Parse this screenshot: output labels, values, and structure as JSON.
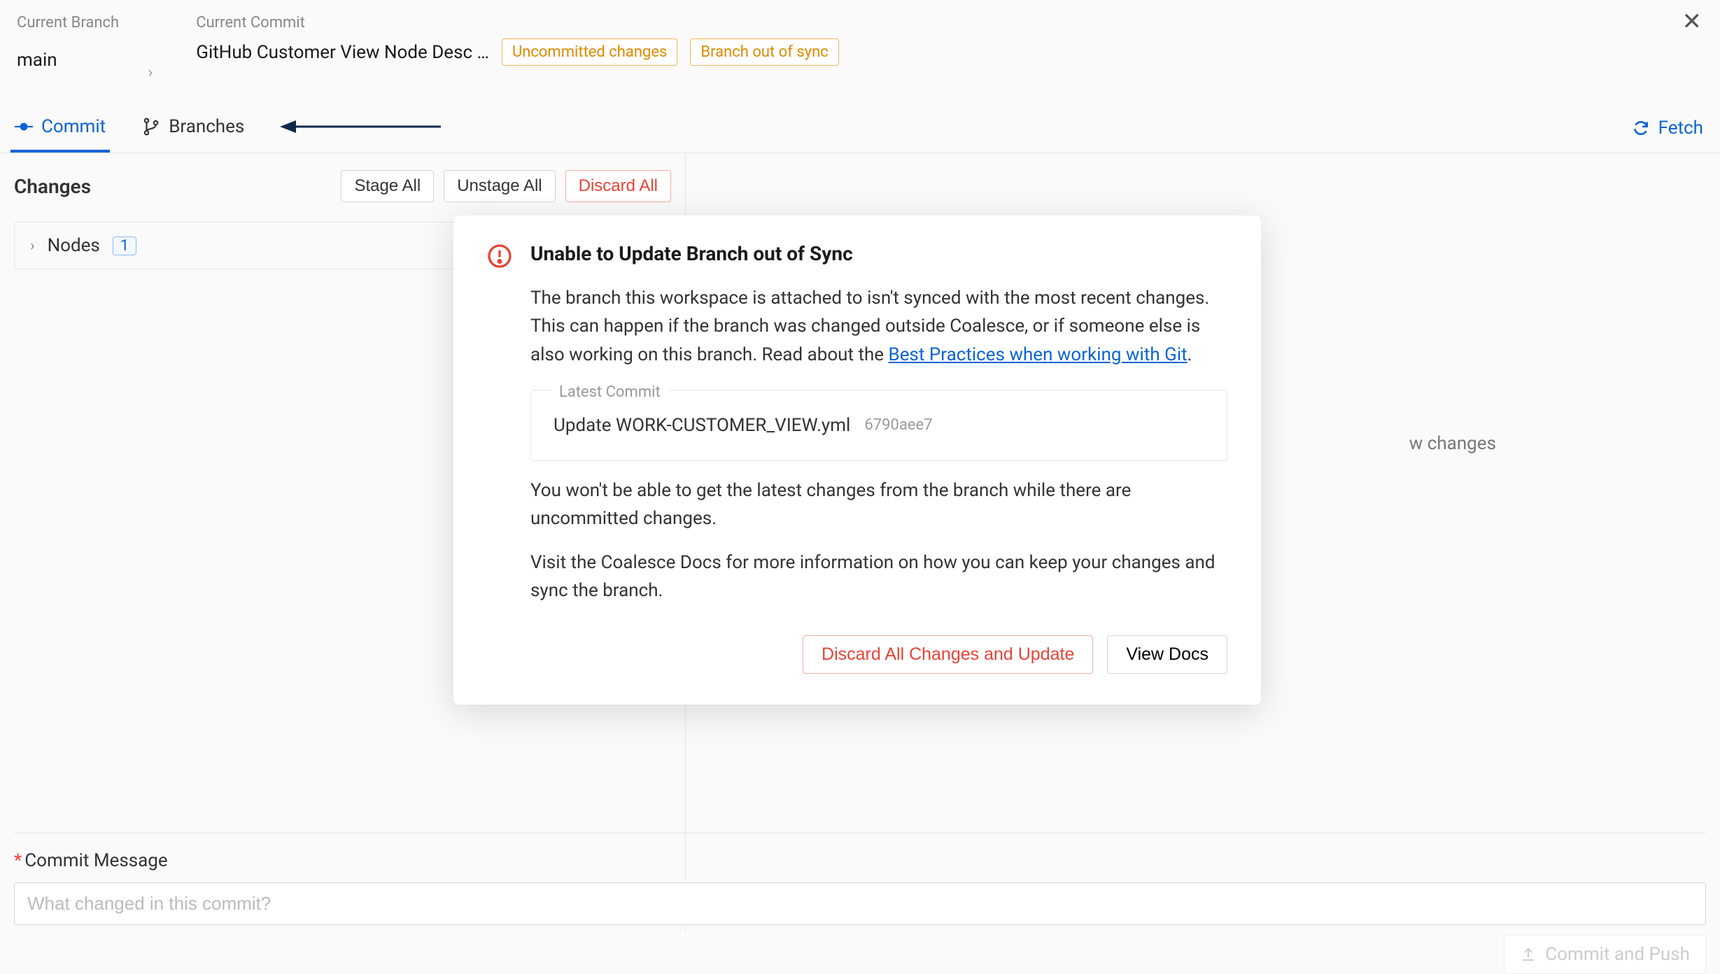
{
  "header": {
    "branch_label": "Current Branch",
    "branch_value": "main",
    "commit_label": "Current Commit",
    "commit_value": "GitHub Customer View Node Desc …",
    "badge_uncommitted": "Uncommitted changes",
    "badge_sync": "Branch out of sync"
  },
  "tabs": {
    "commit": "Commit",
    "branches": "Branches",
    "fetch": "Fetch"
  },
  "changes": {
    "title": "Changes",
    "stage_all": "Stage All",
    "unstage_all": "Unstage All",
    "discard_all": "Discard All",
    "nodes_label": "Nodes",
    "nodes_count": "1"
  },
  "hint_right": "w changes",
  "commit_message": {
    "label": "Commit Message",
    "placeholder": "What changed in this commit?",
    "push_label": "Commit and Push"
  },
  "modal": {
    "title": "Unable to Update Branch out of Sync",
    "para1_a": "The branch this workspace is attached to isn't synced with the most recent changes. This can happen if the branch was changed outside Coalesce, or if someone else is also working on this branch. Read about the ",
    "link_text": "Best Practices when working with Git",
    "para1_b": ".",
    "latest_legend": "Latest Commit",
    "latest_msg": "Update WORK-CUSTOMER_VIEW.yml",
    "latest_sha": "6790aee7",
    "para2": "You won't be able to get the latest changes from the branch while there are uncommitted changes.",
    "para3": "Visit the Coalesce Docs for more information on how you can keep your changes and sync the branch.",
    "discard_btn": "Discard All Changes and Update",
    "docs_btn": "View Docs"
  }
}
